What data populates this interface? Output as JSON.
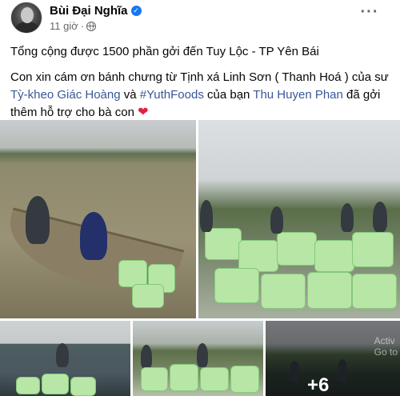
{
  "post": {
    "author": "Bùi Đại Nghĩa",
    "time": "11 giờ",
    "separator": "·",
    "verified_mark": "✓",
    "more_label": "···",
    "line1": "Tổng cộng được 1500 phần gởi đến Tuy Lộc - TP Yên Bái",
    "line2_part1": "Con xin cám ơn bánh chưng từ Tịnh xá Linh Sơn ( Thanh Hoá ) của sư ",
    "mention1": "Tỳ-kheo Giác Hoàng",
    "line2_part2": " và ",
    "hashtag": "#YuthFoods",
    "line2_part3": " của bạn ",
    "mention2": "Thu Huyen Phan",
    "line2_part4": " đã gởi thêm hỗ trợ cho bà con ",
    "heart": "❤"
  },
  "photos": {
    "more_count": "+6",
    "watermark_line1": "Activ",
    "watermark_line2": "Go to"
  },
  "icons": [
    "verified-icon",
    "globe-icon",
    "more-options-icon",
    "heart-emoji"
  ],
  "colors": {
    "link": "#385898",
    "verified": "#1877f2",
    "heart": "#e41e3f",
    "muted": "#65676b"
  }
}
